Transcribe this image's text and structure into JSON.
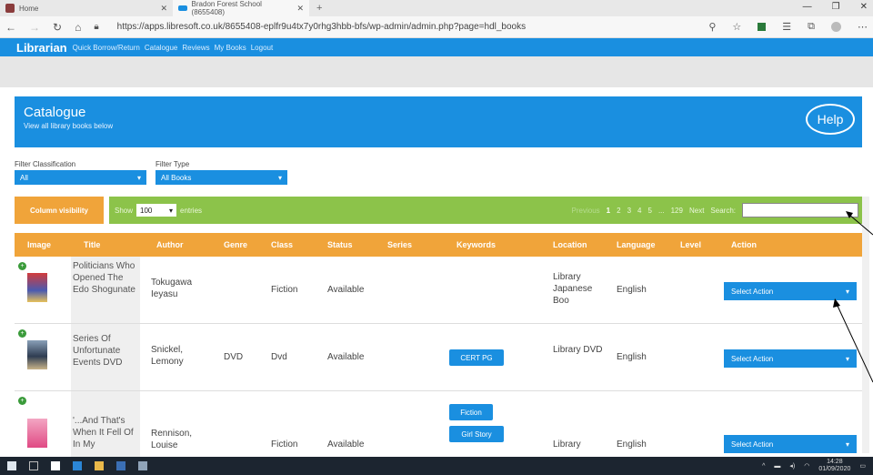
{
  "browser": {
    "tabs": [
      {
        "label": "Home"
      },
      {
        "label": "Bradon Forest School (8655408)"
      }
    ],
    "url": "https://apps.libresoft.co.uk/8655408-eplfr9u4tx7y0rhg3hbb-bfs/wp-admin/admin.php?page=hdl_books"
  },
  "topnav": {
    "brand": "Librarian",
    "links": [
      "Quick Borrow/Return",
      "Catalogue",
      "Reviews",
      "My Books",
      "Logout"
    ]
  },
  "hero": {
    "title": "Catalogue",
    "subtitle": "View all library books below",
    "help": "Help"
  },
  "filters": {
    "classification_label": "Filter Classification",
    "classification_value": "All",
    "type_label": "Filter Type",
    "type_value": "All Books"
  },
  "toolbar": {
    "column_visibility": "Column visibility",
    "show": "Show",
    "entries_value": "100",
    "entries": "entries",
    "previous": "Previous",
    "pages": [
      "1",
      "2",
      "3",
      "4",
      "5",
      "...",
      "129"
    ],
    "next": "Next",
    "search": "Search:"
  },
  "table": {
    "columns": [
      "Image",
      "Title",
      "Author",
      "Genre",
      "Class",
      "Status",
      "Series",
      "Keywords",
      "Location",
      "Language",
      "Level",
      "Action"
    ],
    "rows": [
      {
        "title": "Politicians Who Opened The Edo Shogunate",
        "author": "Tokugawa Ieyasu",
        "genre": "",
        "class": "Fiction",
        "status": "Available",
        "keywords": [],
        "location": "Library Japanese Boo",
        "language": "English",
        "action": "Select Action"
      },
      {
        "title": "Series Of Unfortunate Events DVD",
        "author": "Snickel, Lemony",
        "genre": "DVD",
        "class": "Dvd",
        "status": "Available",
        "keywords": [
          "CERT PG"
        ],
        "location": "Library DVD",
        "language": "English",
        "action": "Select Action"
      },
      {
        "title": "'...And That's When It Fell Of In My",
        "author": "Rennison, Louise",
        "genre": "",
        "class": "Fiction",
        "status": "Available",
        "keywords": [
          "Fiction",
          "Girl Story"
        ],
        "location": "Library",
        "language": "English",
        "action": "Select Action"
      }
    ]
  },
  "taskbar": {
    "time": "14:28",
    "date": "01/09/2020"
  },
  "colors": {
    "primary": "#1a8fe0",
    "orange": "#f0a43a",
    "green": "#8cc34a"
  }
}
